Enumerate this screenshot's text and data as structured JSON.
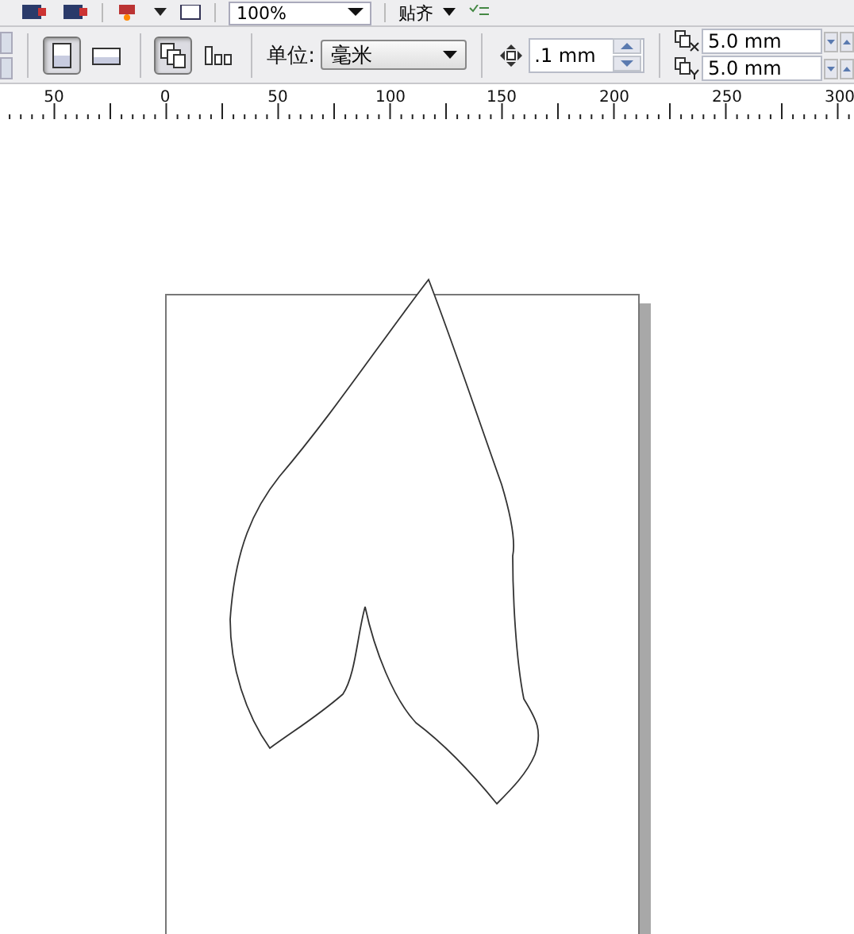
{
  "toolbar_top": {
    "zoom": "100%",
    "snap": "贴齐"
  },
  "property_bar": {
    "orientation": [
      {
        "kind": "portrait",
        "selected": true
      },
      {
        "kind": "landscape",
        "selected": false
      }
    ],
    "page_scope": [
      {
        "kind": "all",
        "selected": true
      },
      {
        "kind": "current",
        "selected": false
      }
    ],
    "unit_label": "单位:",
    "unit": "毫米",
    "nudge": ".1 mm",
    "duplicate_x": "5.0 mm",
    "duplicate_y": "5.0 mm"
  },
  "ruler": {
    "labels": [
      "50",
      "0",
      "50",
      "100",
      "150",
      "200",
      "250",
      "300"
    ]
  }
}
